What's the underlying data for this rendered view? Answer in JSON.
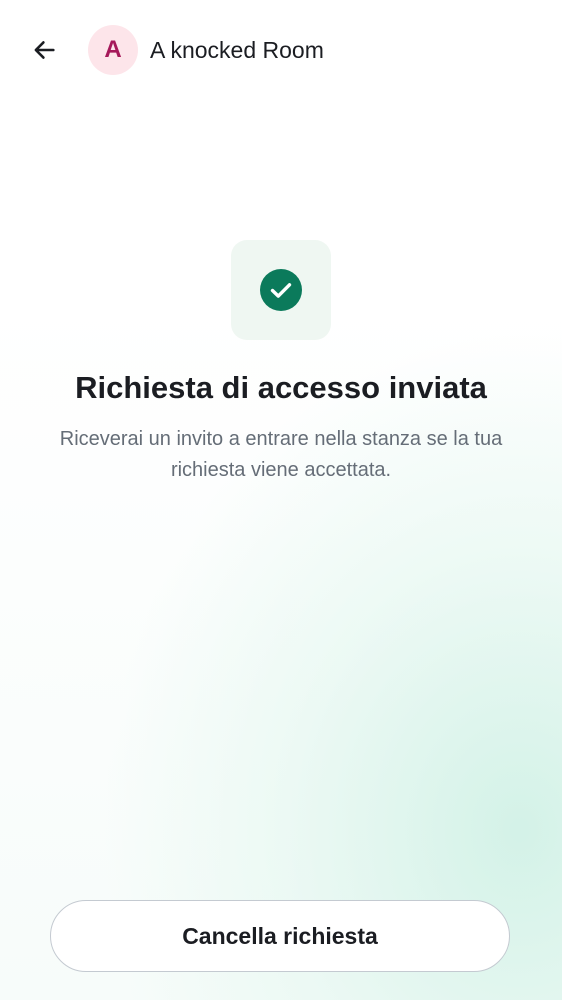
{
  "header": {
    "back_icon": "arrow-left-icon",
    "avatar_letter": "A",
    "avatar_bg": "#fde5ea",
    "avatar_fg": "#a6195a",
    "room_name": "A knocked Room"
  },
  "status": {
    "icon": "check-circle-icon",
    "icon_color": "#0b7a5b",
    "title": "Richiesta di accesso inviata",
    "description": "Riceverai un invito a entrare nella stanza se la tua richiesta viene accettata."
  },
  "actions": {
    "cancel_label": "Cancella richiesta"
  }
}
